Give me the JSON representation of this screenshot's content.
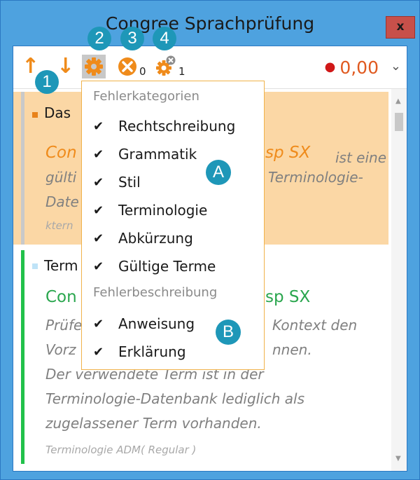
{
  "window": {
    "title": "Congree Sprachprüfung",
    "close_label": "x"
  },
  "toolbar": {
    "up_arrow": "↑",
    "down_arrow": "↓",
    "settings_icon": "gear-icon",
    "errors_icon": "x-circle-icon",
    "errors_count": "0",
    "terms_icon": "gear-x-icon",
    "terms_count": "1",
    "score": "0,00",
    "score_dot": "●",
    "dropdown": "⌄"
  },
  "cards": [
    {
      "category": "Das",
      "category_color": "#e8821a",
      "term": "Con",
      "term_end": "sp SX",
      "term_suffix": "ist eine",
      "term_color": "#ef8b1b",
      "desc_lines": [
        "gülti",
        "Date"
      ],
      "desc_right": [
        "Terminologie-"
      ],
      "source": "ktern"
    },
    {
      "category": "Term",
      "category_color": "#bfe3f7",
      "term": "Con",
      "term_end": "sp SX",
      "term_color": "#2aa64e",
      "desc_lines": [
        "Prüfe",
        "Vorz",
        "Der verwendete Term ist in der",
        "Terminologie-Datenbank lediglich als",
        "zugelassener Term vorhanden."
      ],
      "desc_right": [
        "Kontext den",
        "nnen."
      ],
      "source": "Terminologie ADM( Regular )"
    }
  ],
  "menu": {
    "header1": "Fehlerkategorien",
    "items1": [
      "Rechtschreibung",
      "Grammatik",
      "Stil",
      "Terminologie",
      "Abkürzung",
      "Gültige Terme"
    ],
    "header2": "Fehlerbeschreibung",
    "items2": [
      "Anweisung",
      "Erklärung"
    ],
    "check": "✔"
  },
  "callouts": {
    "n1": "1",
    "n2": "2",
    "n3": "3",
    "n4": "4",
    "a": "A",
    "b": "B"
  },
  "scrollbar": {
    "up": "▲",
    "down": "▼"
  },
  "colors": {
    "accent": "#ef8b1b",
    "window_border": "#4ea2df",
    "callout": "#1e97b8",
    "close": "#c7504a"
  }
}
